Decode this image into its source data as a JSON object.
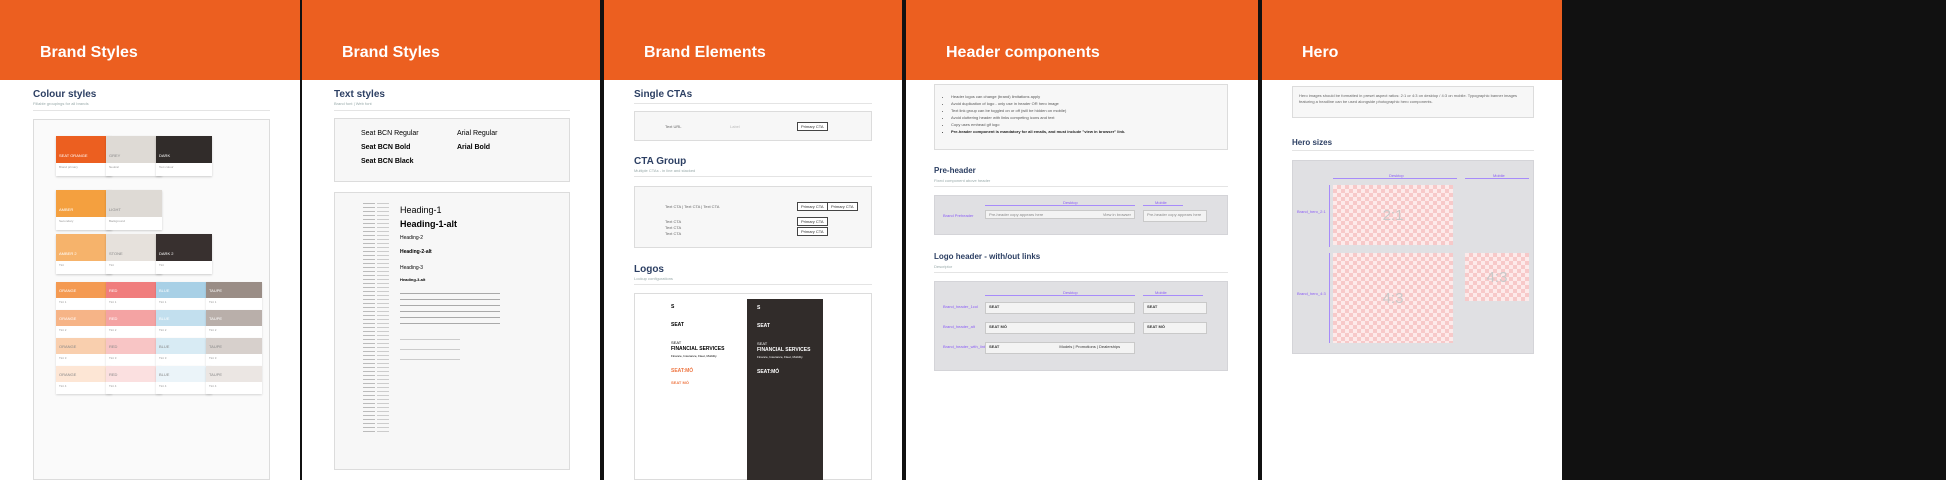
{
  "boards": [
    {
      "title": "Brand Styles",
      "section": "Colour styles",
      "section_sub": "Fillable groupings for all brands"
    },
    {
      "title": "Brand Styles",
      "section": "Text styles",
      "section_sub": "Brand font | Web font",
      "fonts": [
        "Seat BCN Regular",
        "Seat BCN Bold",
        "Seat BCN Black",
        "Arial Regular",
        "Arial Bold"
      ],
      "headings": [
        "Heading-1",
        "Heading-1-alt",
        "Heading-2",
        "Heading-2-alt",
        "Heading-3",
        "Heading-3-alt"
      ]
    },
    {
      "title": "Brand Elements",
      "cta_single": "Single CTAs",
      "cta_group": "CTA Group",
      "cta_group_sub": "Multiple CTAs - in line and stacked",
      "logos": "Logos",
      "logos_sub": "Lockup configurations",
      "primary_cta": "Primary CTA",
      "fin_small": "SEAT",
      "fin_big": "FINANCIAL SERVICES",
      "fin_tag": "Finance, Insurance, Fleet, Mobility",
      "seatmo": "SEAT:MÓ",
      "mo_small": "SEAT MÓ"
    },
    {
      "title": "Header components",
      "notes": [
        "Header logos can change (brand) limitations apply",
        "Avoid duplication of logo - only use in header OR hero image",
        "Text link group can be toggled on or off (will be hidden on mobile)",
        "Avoid cluttering header with links competing icons and text",
        "Copy uses emhead gif logo",
        "Pre-header component is mandatory for all emails, and must include \"view in browser\" link."
      ],
      "preheader": "Pre-header",
      "preheader_sub": "Fixed component above header",
      "desktop": "Desktop",
      "mobile": "Mobile",
      "pre_label": "Brand Preheader",
      "pre_text": "Pre-header copy appears here",
      "pre_view": "View in browser",
      "logo_header": "Logo header - with/out links",
      "logo_header_sub": "Descriptor",
      "row_labels": [
        "Brand_header_1col",
        "Brand_header_alt",
        "Brand_header_with_links"
      ],
      "seat": "SEAT",
      "seatmo": "SEAT MÓ",
      "links": "Models  |  Promotions  |  Dealerships"
    },
    {
      "title": "Hero",
      "intro": "Hero images should be formatted in preset aspect ratios: 2:1 or 4:3 on desktop / 4:3 on mobile. Typographic banner images featuring a headline can be used alongside photographic hero components.",
      "sizes": "Hero sizes",
      "desktop": "Desktop",
      "mobile": "Mobile",
      "ratio1": "2:1",
      "ratio2": "4:3",
      "ratio3": "4:3",
      "row1": "Brand_hero_2:1",
      "row2": "Brand_hero_4:3"
    }
  ],
  "colors": {
    "accent": "#ec5f20",
    "dark": "#312c2a",
    "purple": "#8b5cf6"
  }
}
